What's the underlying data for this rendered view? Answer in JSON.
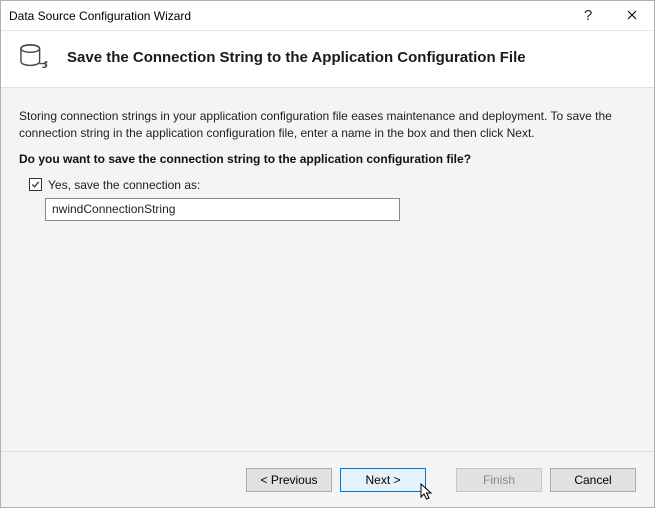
{
  "titlebar": {
    "title": "Data Source Configuration Wizard"
  },
  "header": {
    "title": "Save the Connection String to the Application Configuration File"
  },
  "content": {
    "intro": "Storing connection strings in your application configuration file eases maintenance and deployment. To save the connection string in the application configuration file, enter a name in the box and then click Next.",
    "question": "Do you want to save the connection string to the application configuration file?",
    "checkbox_label": "Yes, save the connection as:",
    "connection_name": "nwindConnectionString"
  },
  "footer": {
    "previous": "< Previous",
    "next": "Next >",
    "finish": "Finish",
    "cancel": "Cancel"
  }
}
